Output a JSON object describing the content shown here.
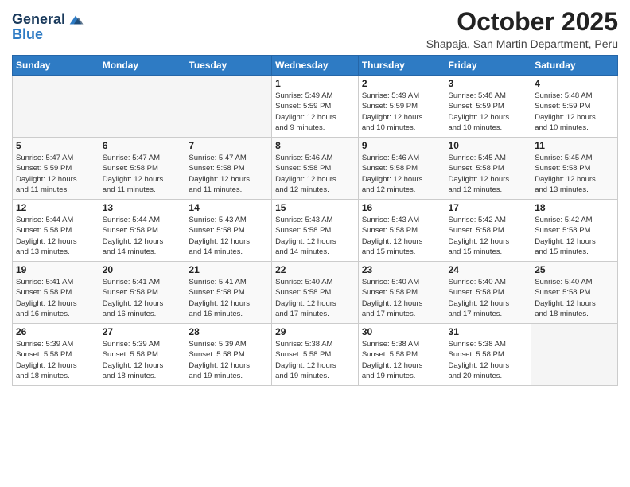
{
  "header": {
    "logo_line1": "General",
    "logo_line2": "Blue",
    "month_title": "October 2025",
    "location": "Shapaja, San Martin Department, Peru"
  },
  "calendar": {
    "days_of_week": [
      "Sunday",
      "Monday",
      "Tuesday",
      "Wednesday",
      "Thursday",
      "Friday",
      "Saturday"
    ],
    "weeks": [
      [
        {
          "day": "",
          "info": ""
        },
        {
          "day": "",
          "info": ""
        },
        {
          "day": "",
          "info": ""
        },
        {
          "day": "1",
          "info": "Sunrise: 5:49 AM\nSunset: 5:59 PM\nDaylight: 12 hours\nand 9 minutes."
        },
        {
          "day": "2",
          "info": "Sunrise: 5:49 AM\nSunset: 5:59 PM\nDaylight: 12 hours\nand 10 minutes."
        },
        {
          "day": "3",
          "info": "Sunrise: 5:48 AM\nSunset: 5:59 PM\nDaylight: 12 hours\nand 10 minutes."
        },
        {
          "day": "4",
          "info": "Sunrise: 5:48 AM\nSunset: 5:59 PM\nDaylight: 12 hours\nand 10 minutes."
        }
      ],
      [
        {
          "day": "5",
          "info": "Sunrise: 5:47 AM\nSunset: 5:59 PM\nDaylight: 12 hours\nand 11 minutes."
        },
        {
          "day": "6",
          "info": "Sunrise: 5:47 AM\nSunset: 5:58 PM\nDaylight: 12 hours\nand 11 minutes."
        },
        {
          "day": "7",
          "info": "Sunrise: 5:47 AM\nSunset: 5:58 PM\nDaylight: 12 hours\nand 11 minutes."
        },
        {
          "day": "8",
          "info": "Sunrise: 5:46 AM\nSunset: 5:58 PM\nDaylight: 12 hours\nand 12 minutes."
        },
        {
          "day": "9",
          "info": "Sunrise: 5:46 AM\nSunset: 5:58 PM\nDaylight: 12 hours\nand 12 minutes."
        },
        {
          "day": "10",
          "info": "Sunrise: 5:45 AM\nSunset: 5:58 PM\nDaylight: 12 hours\nand 12 minutes."
        },
        {
          "day": "11",
          "info": "Sunrise: 5:45 AM\nSunset: 5:58 PM\nDaylight: 12 hours\nand 13 minutes."
        }
      ],
      [
        {
          "day": "12",
          "info": "Sunrise: 5:44 AM\nSunset: 5:58 PM\nDaylight: 12 hours\nand 13 minutes."
        },
        {
          "day": "13",
          "info": "Sunrise: 5:44 AM\nSunset: 5:58 PM\nDaylight: 12 hours\nand 14 minutes."
        },
        {
          "day": "14",
          "info": "Sunrise: 5:43 AM\nSunset: 5:58 PM\nDaylight: 12 hours\nand 14 minutes."
        },
        {
          "day": "15",
          "info": "Sunrise: 5:43 AM\nSunset: 5:58 PM\nDaylight: 12 hours\nand 14 minutes."
        },
        {
          "day": "16",
          "info": "Sunrise: 5:43 AM\nSunset: 5:58 PM\nDaylight: 12 hours\nand 15 minutes."
        },
        {
          "day": "17",
          "info": "Sunrise: 5:42 AM\nSunset: 5:58 PM\nDaylight: 12 hours\nand 15 minutes."
        },
        {
          "day": "18",
          "info": "Sunrise: 5:42 AM\nSunset: 5:58 PM\nDaylight: 12 hours\nand 15 minutes."
        }
      ],
      [
        {
          "day": "19",
          "info": "Sunrise: 5:41 AM\nSunset: 5:58 PM\nDaylight: 12 hours\nand 16 minutes."
        },
        {
          "day": "20",
          "info": "Sunrise: 5:41 AM\nSunset: 5:58 PM\nDaylight: 12 hours\nand 16 minutes."
        },
        {
          "day": "21",
          "info": "Sunrise: 5:41 AM\nSunset: 5:58 PM\nDaylight: 12 hours\nand 16 minutes."
        },
        {
          "day": "22",
          "info": "Sunrise: 5:40 AM\nSunset: 5:58 PM\nDaylight: 12 hours\nand 17 minutes."
        },
        {
          "day": "23",
          "info": "Sunrise: 5:40 AM\nSunset: 5:58 PM\nDaylight: 12 hours\nand 17 minutes."
        },
        {
          "day": "24",
          "info": "Sunrise: 5:40 AM\nSunset: 5:58 PM\nDaylight: 12 hours\nand 17 minutes."
        },
        {
          "day": "25",
          "info": "Sunrise: 5:40 AM\nSunset: 5:58 PM\nDaylight: 12 hours\nand 18 minutes."
        }
      ],
      [
        {
          "day": "26",
          "info": "Sunrise: 5:39 AM\nSunset: 5:58 PM\nDaylight: 12 hours\nand 18 minutes."
        },
        {
          "day": "27",
          "info": "Sunrise: 5:39 AM\nSunset: 5:58 PM\nDaylight: 12 hours\nand 18 minutes."
        },
        {
          "day": "28",
          "info": "Sunrise: 5:39 AM\nSunset: 5:58 PM\nDaylight: 12 hours\nand 19 minutes."
        },
        {
          "day": "29",
          "info": "Sunrise: 5:38 AM\nSunset: 5:58 PM\nDaylight: 12 hours\nand 19 minutes."
        },
        {
          "day": "30",
          "info": "Sunrise: 5:38 AM\nSunset: 5:58 PM\nDaylight: 12 hours\nand 19 minutes."
        },
        {
          "day": "31",
          "info": "Sunrise: 5:38 AM\nSunset: 5:58 PM\nDaylight: 12 hours\nand 20 minutes."
        },
        {
          "day": "",
          "info": ""
        }
      ]
    ]
  }
}
